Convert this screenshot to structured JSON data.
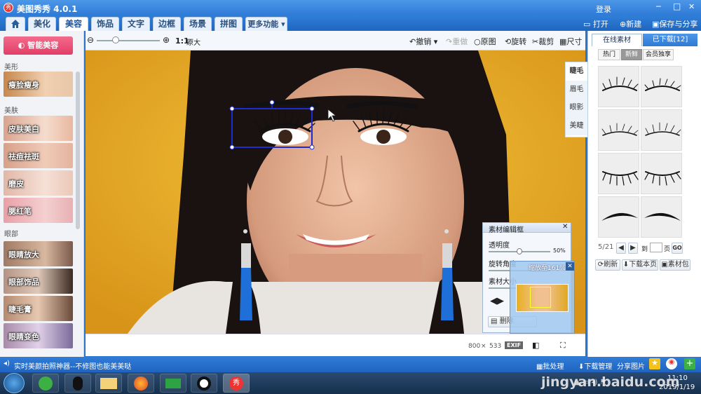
{
  "window": {
    "title": "美图秀秀 4.0.1",
    "login": "登录",
    "min": "─",
    "max": "□",
    "close": "✕"
  },
  "tabs": [
    {
      "label": "美化"
    },
    {
      "label": "美容"
    },
    {
      "label": "饰品"
    },
    {
      "label": "文字"
    },
    {
      "label": "边框"
    },
    {
      "label": "场景"
    },
    {
      "label": "拼图"
    },
    {
      "label": "更多功能 ▾"
    }
  ],
  "top_actions": {
    "open": "打开",
    "new": "新建",
    "save": "保存与分享"
  },
  "toolbar": {
    "ratio": "1:1",
    "original_size": "原大",
    "undo": "撤销",
    "redo": "重做",
    "original": "原图",
    "rotate": "旋转",
    "crop": "裁剪",
    "size": "尺寸"
  },
  "left_panel": {
    "smart_button": "智能美容",
    "sections": [
      {
        "header": "美形",
        "items": [
          {
            "label": "瘦脸瘦身"
          }
        ]
      },
      {
        "header": "美肤",
        "items": [
          {
            "label": "皮肤美白"
          },
          {
            "label": "祛痘祛斑"
          },
          {
            "label": "磨皮"
          },
          {
            "label": "腮红笔"
          }
        ]
      },
      {
        "header": "眼部",
        "items": [
          {
            "label": "眼睛放大"
          },
          {
            "label": "眼部饰品"
          },
          {
            "label": "睫毛膏"
          },
          {
            "label": "眼睛变色"
          }
        ]
      }
    ]
  },
  "side_tabs": [
    {
      "label": "睫毛"
    },
    {
      "label": "眉毛"
    },
    {
      "label": "眼影"
    },
    {
      "label": "美睫"
    }
  ],
  "right_panel": {
    "tab_online": "在线素材",
    "tab_downloaded": "已下载[12]",
    "filters": [
      "热门",
      "新鲜",
      "会员独享"
    ],
    "page_info": "5/21",
    "goto_label": "到",
    "page_label": "页",
    "go": "GO",
    "refresh": "刷新",
    "download_page": "下载本页",
    "material_pack": "素材包"
  },
  "edit_panel": {
    "title": "素材编辑框",
    "transparency_label": "透明度",
    "transparency_value": "50%",
    "transparency": 0.5,
    "rotate_label": "旋转角度",
    "size_label": "素材大小",
    "delete_label": "删除"
  },
  "preview": {
    "zoom_text": "缩放至161%"
  },
  "bottom_info": {
    "width": "800",
    "times": "×",
    "height": "533",
    "exif": "EXIF"
  },
  "statusbar": {
    "message": "实时美颜拍照神器--不修图也能美美哒",
    "batch": "批处理",
    "download_manager": "下载管理",
    "share_image": "分享图片"
  },
  "taskbar": {
    "time": "11:10",
    "date": "2019/1/19"
  },
  "watermark": "jingyan.baidu.com",
  "colors": {
    "accent": "#2e7ad6",
    "smart_button": "#e8456a",
    "selection": "#1e2ccf"
  }
}
